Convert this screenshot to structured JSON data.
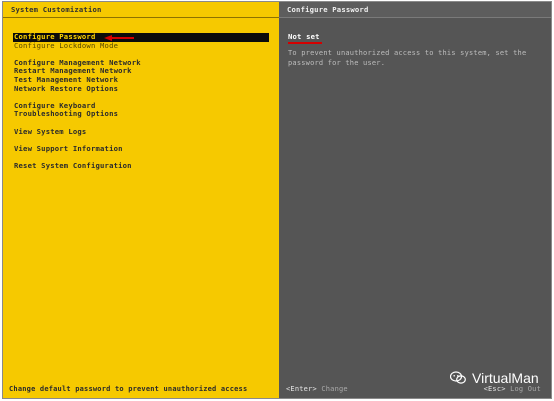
{
  "left_panel": {
    "title": "System Customization",
    "menu": [
      {
        "label": "Configure Password",
        "selected": true
      },
      {
        "label": "Configure Lockdown Mode"
      },
      {
        "label": "Configure Management Network"
      },
      {
        "label": "Restart Management Network"
      },
      {
        "label": "Test Management Network"
      },
      {
        "label": "Network Restore Options"
      },
      {
        "label": "Configure Keyboard"
      },
      {
        "label": "Troubleshooting Options"
      },
      {
        "label": "View System Logs"
      },
      {
        "label": "View Support Information"
      },
      {
        "label": "Reset System Configuration"
      }
    ],
    "footer": "Change default password to prevent unauthorized access"
  },
  "right_panel": {
    "title": "Configure Password",
    "status": "Not set",
    "description": "To prevent unauthorized access to this system, set the password for the user.",
    "footer_left_key": "<Enter>",
    "footer_left_action": "Change",
    "footer_right_key": "<Esc>",
    "footer_right_action": "Log Out"
  },
  "watermark": {
    "text": "VirtualMan",
    "icon": "wechat-icon"
  },
  "colors": {
    "left_bg": "#f6c900",
    "right_bg": "#555555",
    "selected_bg": "#0b0b0b",
    "selected_fg": "#ffd400",
    "annotation_red": "#d40000"
  }
}
